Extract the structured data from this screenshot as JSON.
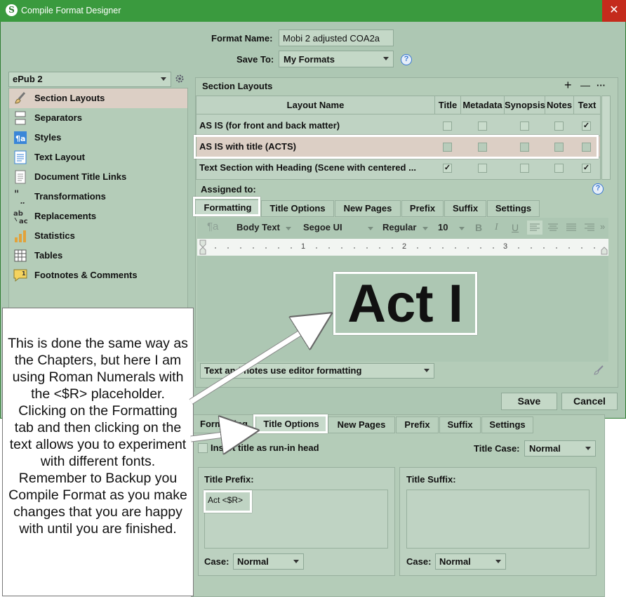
{
  "window": {
    "title": "Compile Format Designer",
    "close_glyph": "✕",
    "app_icon_letter": "S"
  },
  "header": {
    "format_name_label": "Format Name:",
    "format_name_value": "Mobi 2 adjusted COA2a",
    "save_to_label": "Save To:",
    "save_to_value": "My Formats",
    "help_glyph": "?"
  },
  "sidebar": {
    "format_select": "ePub 2",
    "items": [
      {
        "label": "Section Layouts",
        "icon": "brush-icon",
        "selected": true
      },
      {
        "label": "Separators",
        "icon": "separator-icon"
      },
      {
        "label": "Styles",
        "icon": "styles-icon"
      },
      {
        "label": "Text Layout",
        "icon": "text-layout-icon"
      },
      {
        "label": "Document Title Links",
        "icon": "document-icon"
      },
      {
        "label": "Transformations",
        "icon": "quotes-icon"
      },
      {
        "label": "Replacements",
        "icon": "replace-icon"
      },
      {
        "label": "Statistics",
        "icon": "bar-chart-icon"
      },
      {
        "label": "Tables",
        "icon": "table-icon"
      },
      {
        "label": "Footnotes & Comments",
        "icon": "comment-icon",
        "badge": "1"
      }
    ]
  },
  "section_layouts": {
    "title": "Section Layouts",
    "add_glyph": "+",
    "remove_glyph": "—",
    "more_glyph": "···",
    "columns": [
      "Layout Name",
      "Title",
      "Metadata",
      "Synopsis",
      "Notes",
      "Text"
    ],
    "rows": [
      {
        "name": "AS IS (for front and back matter)",
        "title": false,
        "metadata": false,
        "synopsis": false,
        "notes": false,
        "text": true
      },
      {
        "name": "AS IS with title (ACTS)",
        "title": false,
        "metadata": false,
        "synopsis": false,
        "notes": false,
        "text": false,
        "selected": true
      },
      {
        "name": "Text Section with Heading (Scene with centered ...",
        "title": true,
        "metadata": false,
        "synopsis": false,
        "notes": false,
        "text": true
      }
    ],
    "check_glyph": "✓",
    "assigned_to_label": "Assigned to:"
  },
  "upper_tabs": [
    "Formatting",
    "Title Options",
    "New Pages",
    "Prefix",
    "Suffix",
    "Settings"
  ],
  "toolbar": {
    "style_glyph": "¶a",
    "paragraph_style": "Body Text",
    "font": "Segoe UI",
    "weight": "Regular",
    "size": "10",
    "bold": "B",
    "italic": "I",
    "underline": "U",
    "more": "»"
  },
  "ruler": {
    "marks": [
      "1",
      "2",
      "3"
    ]
  },
  "preview": {
    "text": "Act I"
  },
  "notes_select": "Text and notes use editor formatting",
  "buttons": {
    "save": "Save",
    "cancel": "Cancel"
  },
  "lower_tabs": [
    "Formatting",
    "Title Options",
    "New Pages",
    "Prefix",
    "Suffix",
    "Settings"
  ],
  "title_options": {
    "run_in_label": "Insert title as run-in head",
    "title_case_label": "Title Case:",
    "title_case_value": "Normal",
    "prefix_label": "Title Prefix:",
    "prefix_value": "Act <$R>",
    "suffix_label": "Title Suffix:",
    "case_label": "Case:",
    "prefix_case": "Normal",
    "suffix_case": "Normal"
  },
  "callout": {
    "text": "This is done the same way as the Chapters, but here I am using Roman Numerals with the <$R> placeholder. Clicking on the Formatting tab and then clicking on the text allows you to experiment with different fonts. Remember to Backup you Compile Format as you make changes that you are happy with until you are finished."
  }
}
